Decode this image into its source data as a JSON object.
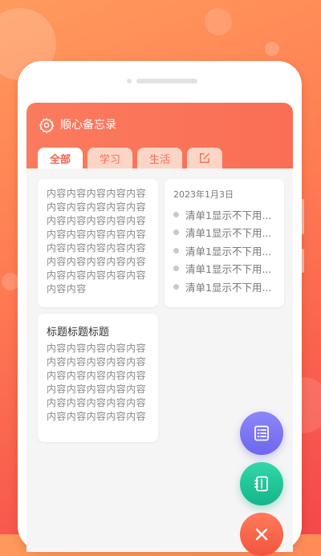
{
  "app": {
    "title": "顺心备忘录",
    "settings_icon": "gear-icon"
  },
  "tabs": [
    {
      "label": "全部",
      "active": true
    },
    {
      "label": "学习",
      "active": false
    },
    {
      "label": "生活",
      "active": false
    },
    {
      "icon": "edit-icon",
      "active": false
    }
  ],
  "notes": [
    {
      "type": "text",
      "content": "内容内容内容内容内容内容内容内容内容内容内容内容内容内容内容内容内容内容内容内容内容内容内容内容内容内容内容内容内容内容内容内容内容内容内容内容内容"
    },
    {
      "type": "checklist",
      "date": "2023年1月3日",
      "items": [
        "清单1显示不下用...",
        "清单1显示不下用...",
        "清单1显示不下用...",
        "清单1显示不下用...",
        "清单1显示不下用..."
      ]
    },
    {
      "type": "titled",
      "title": "标题标题标题",
      "content": "内容内容内容内容内容内容内容内容内容内容内容内容内容内容内容内容内容内容内容内容内容内容内容内容内容内容内容内容内容内容"
    }
  ],
  "fabs": [
    {
      "name": "checklist-fab",
      "icon": "list-icon",
      "color": "#7a73f2"
    },
    {
      "name": "notebook-fab",
      "icon": "notebook-icon",
      "color": "#1fc597"
    },
    {
      "name": "close-fab",
      "icon": "close-icon",
      "color": "#f4604b"
    }
  ],
  "colors": {
    "accent": "#fa6e55",
    "background_top": "#ff9a5c",
    "background_bottom": "#f4484a"
  }
}
